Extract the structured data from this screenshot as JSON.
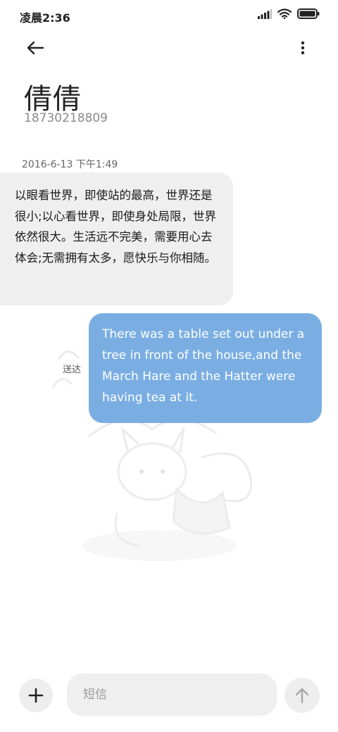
{
  "status_bar": {
    "time": "凌晨2:36",
    "icons": [
      "signal-icon",
      "wifi-icon",
      "battery-icon"
    ]
  },
  "header": {
    "back_icon": "arrow-left-icon",
    "more_icon": "more-vertical-icon"
  },
  "contact": {
    "name": "倩倩",
    "number": "18730218809"
  },
  "conversation": {
    "timestamp": "2016-6-13 下午1:49",
    "incoming_message": "以眼看世界，即使站的最高，世界还是很小;以心看世界，即使身处局限，世界依然很大。生活远不完美，需要用心去体会;无需拥有太多，愿快乐与你相随。",
    "outgoing_message": "There was a table set out under a tree in front of the house,and the March Hare and the Hatter were having tea at it.",
    "outgoing_status": "送达"
  },
  "composer": {
    "placeholder": "短信",
    "add_icon": "plus-icon",
    "send_icon": "arrow-up-icon"
  },
  "colors": {
    "outgoing_bubble": "#7aaee3",
    "incoming_bubble": "#efefef",
    "background": "#ffffff"
  }
}
